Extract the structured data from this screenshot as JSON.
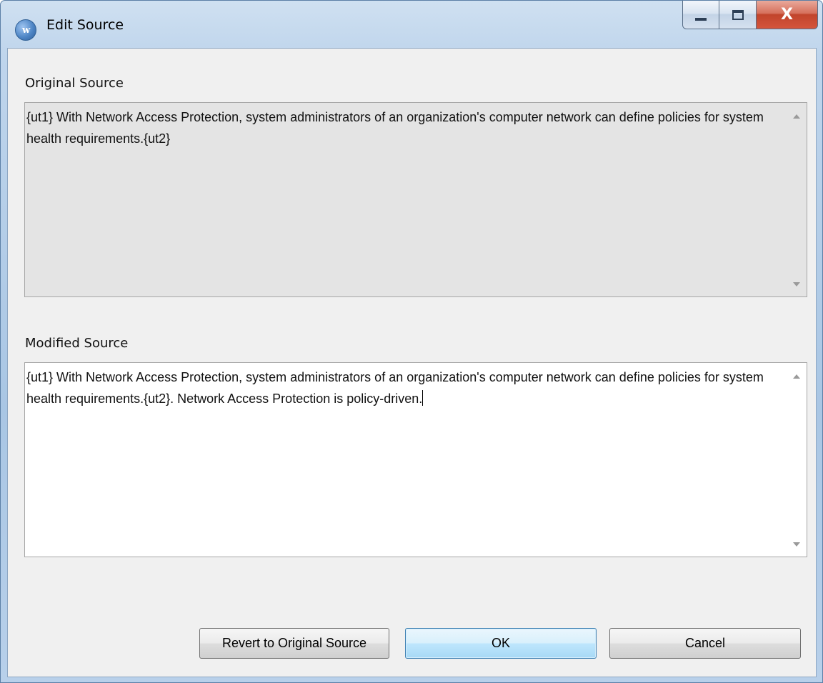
{
  "window": {
    "title": "Edit Source",
    "app_icon": "w-logo-icon",
    "controls": {
      "minimize": "minimize-icon",
      "maximize": "maximize-icon",
      "close_label": "X"
    }
  },
  "original": {
    "label": "Original Source",
    "text": "{ut1} With Network Access Protection, system administrators of an organization's computer network can define policies for system health requirements.{ut2}"
  },
  "modified": {
    "label": "Modified Source",
    "text": "{ut1} With Network Access Protection, system administrators of an organization's computer network can define policies for system health requirements.{ut2}. Network Access Protection is policy-driven."
  },
  "buttons": {
    "revert": "Revert to Original Source",
    "ok": "OK",
    "cancel": "Cancel"
  },
  "colors": {
    "title_bar": "#bfd5ec",
    "client_bg": "#f0f0f0",
    "readonly_bg": "#e4e4e4",
    "ok_accent": "#3c7fb1",
    "close_red": "#c1442c"
  }
}
